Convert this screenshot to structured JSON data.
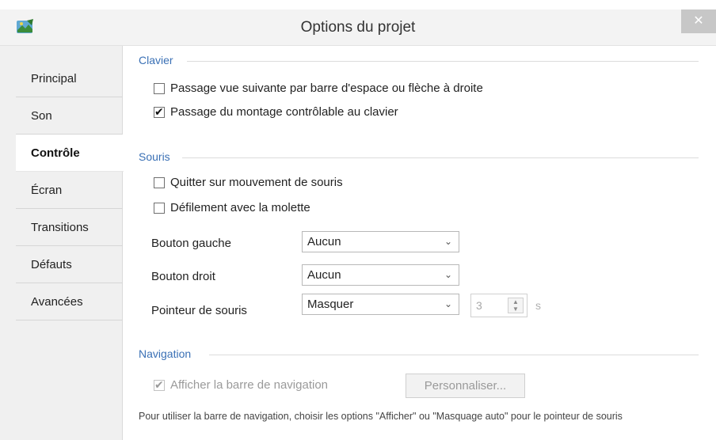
{
  "window": {
    "title": "Options du projet",
    "close_label": "✕"
  },
  "sidebar": {
    "items": [
      {
        "label": "Principal",
        "active": false
      },
      {
        "label": "Son",
        "active": false
      },
      {
        "label": "Contrôle",
        "active": true
      },
      {
        "label": "Écran",
        "active": false
      },
      {
        "label": "Transitions",
        "active": false
      },
      {
        "label": "Défauts",
        "active": false
      },
      {
        "label": "Avancées",
        "active": false
      }
    ]
  },
  "clavier": {
    "title": "Clavier",
    "next_view_option": {
      "label": "Passage vue suivante par barre d'espace ou flèche à droite",
      "checked": false
    },
    "keyboard_control_option": {
      "label": "Passage du montage contrôlable au clavier",
      "checked": true
    }
  },
  "souris": {
    "title": "Souris",
    "quit_on_move_option": {
      "label": "Quitter sur mouvement de souris",
      "checked": false
    },
    "wheel_scroll_option": {
      "label": "Défilement avec la molette",
      "checked": false
    },
    "left_button": {
      "label": "Bouton gauche",
      "value": "Aucun"
    },
    "right_button": {
      "label": "Bouton droit",
      "value": "Aucun"
    },
    "pointer": {
      "label": "Pointeur de souris",
      "value": "Masquer",
      "delay": "3",
      "unit": "s"
    }
  },
  "navigation": {
    "title": "Navigation",
    "show_bar_option": {
      "label": "Afficher la barre de navigation",
      "checked": true,
      "disabled": true
    },
    "customize_button": "Personnaliser...",
    "note": "Pour utiliser la barre de navigation, choisir les options \"Afficher\" ou \"Masquage auto\" pour le pointeur de souris"
  },
  "colors": {
    "section_title": "#3a70b5",
    "sidebar_bg": "#f0f0f0",
    "disabled_text": "#9a9a9a"
  }
}
